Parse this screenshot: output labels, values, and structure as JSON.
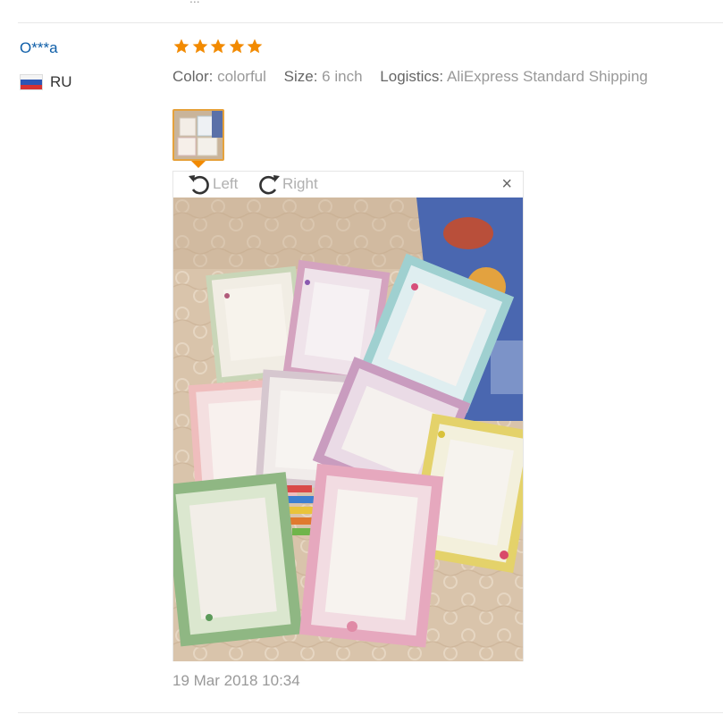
{
  "review": {
    "partial_above": "...",
    "user_name": "O***a",
    "country": "RU",
    "rating": 5,
    "attributes": [
      {
        "key": "Color:",
        "value": "colorful"
      },
      {
        "key": "Size:",
        "value": "6 inch"
      },
      {
        "key": "Logistics:",
        "value": "AliExpress Standard Shipping"
      }
    ],
    "viewer": {
      "rotate_left_label": "Left",
      "rotate_right_label": "Right",
      "close_symbol": "×"
    },
    "date": "19 Mar 2018 10:34"
  },
  "colors": {
    "username": "#0e5ea8",
    "star": "#f28a00",
    "thumb_border": "#e6a23c",
    "muted_text": "#999999"
  },
  "icons": [
    "flag-ru-icon",
    "star-icon",
    "rotate-left-icon",
    "rotate-right-icon",
    "close-icon"
  ]
}
